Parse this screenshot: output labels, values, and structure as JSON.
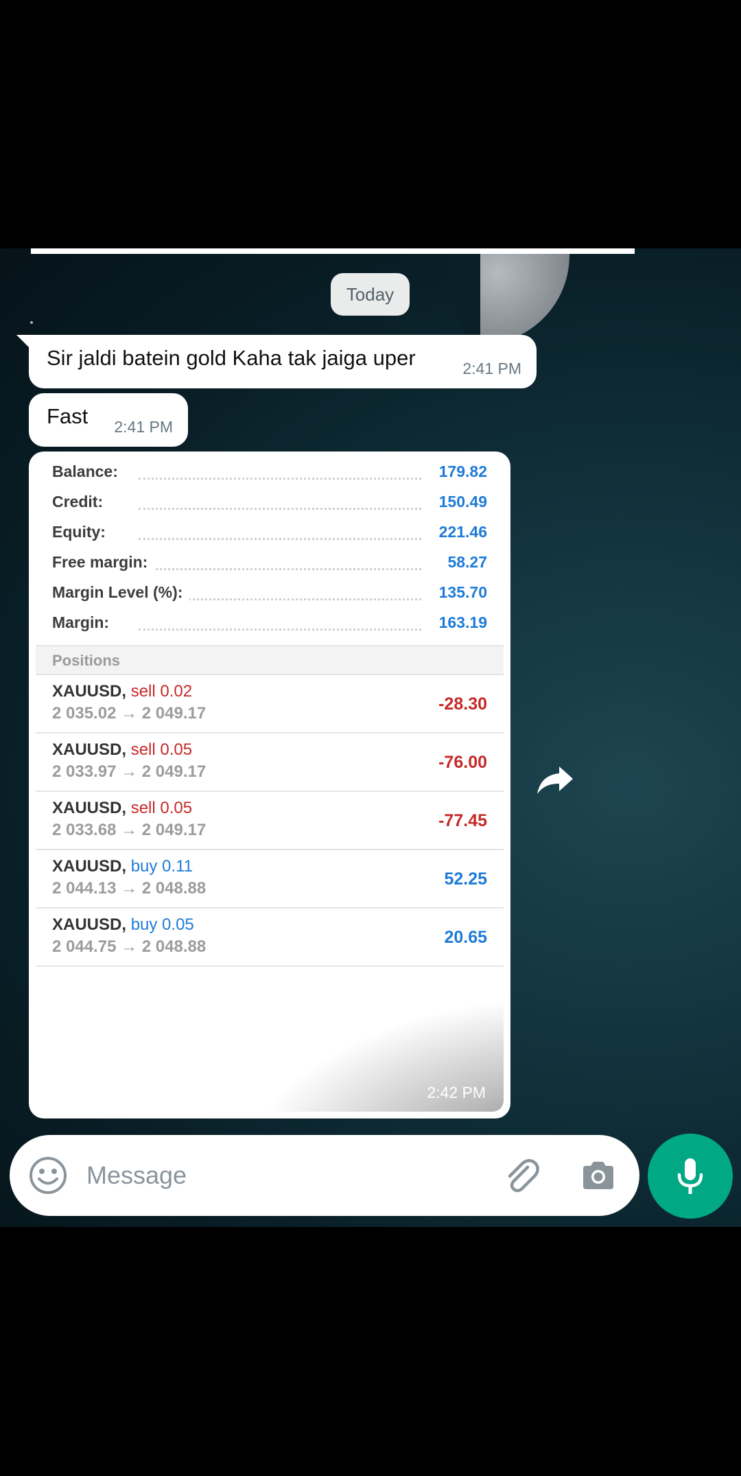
{
  "chat": {
    "date_chip": "Today",
    "messages": [
      {
        "text": "Sir jaldi batein gold Kaha tak jaiga uper",
        "time": "2:41 PM"
      },
      {
        "text": "Fast",
        "time": "2:41 PM"
      }
    ],
    "image_message": {
      "time": "2:42 PM",
      "account": [
        {
          "label": "Balance:",
          "value": "179.82"
        },
        {
          "label": "Credit:",
          "value": "150.49"
        },
        {
          "label": "Equity:",
          "value": "221.46"
        },
        {
          "label": "Free margin:",
          "value": "58.27"
        },
        {
          "label": "Margin Level (%):",
          "value": "135.70"
        },
        {
          "label": "Margin:",
          "value": "163.19"
        }
      ],
      "positions_header": "Positions",
      "positions": [
        {
          "symbol": "XAUUSD,",
          "direction": "sell 0.02",
          "prices": "2 035.02 → 2 049.17",
          "profit": "-28.30"
        },
        {
          "symbol": "XAUUSD,",
          "direction": "sell 0.05",
          "prices": "2 033.97 → 2 049.17",
          "profit": "-76.00"
        },
        {
          "symbol": "XAUUSD,",
          "direction": "sell 0.05",
          "prices": "2 033.68 → 2 049.17",
          "profit": "-77.45"
        },
        {
          "symbol": "XAUUSD,",
          "direction": "buy 0.11",
          "prices": "2 044.13 → 2 048.88",
          "profit": "52.25"
        },
        {
          "symbol": "XAUUSD,",
          "direction": "buy 0.05",
          "prices": "2 044.75 → 2 048.88",
          "profit": "20.65"
        }
      ]
    }
  },
  "composer": {
    "placeholder": "Message"
  },
  "icons": {
    "emoji": "emoji-icon",
    "attach": "paperclip-icon",
    "camera": "camera-icon",
    "mic": "mic-icon",
    "forward": "forward-icon"
  },
  "colors": {
    "accent": "#00a884",
    "loss": "#c62828",
    "gain": "#1e7bd7"
  }
}
